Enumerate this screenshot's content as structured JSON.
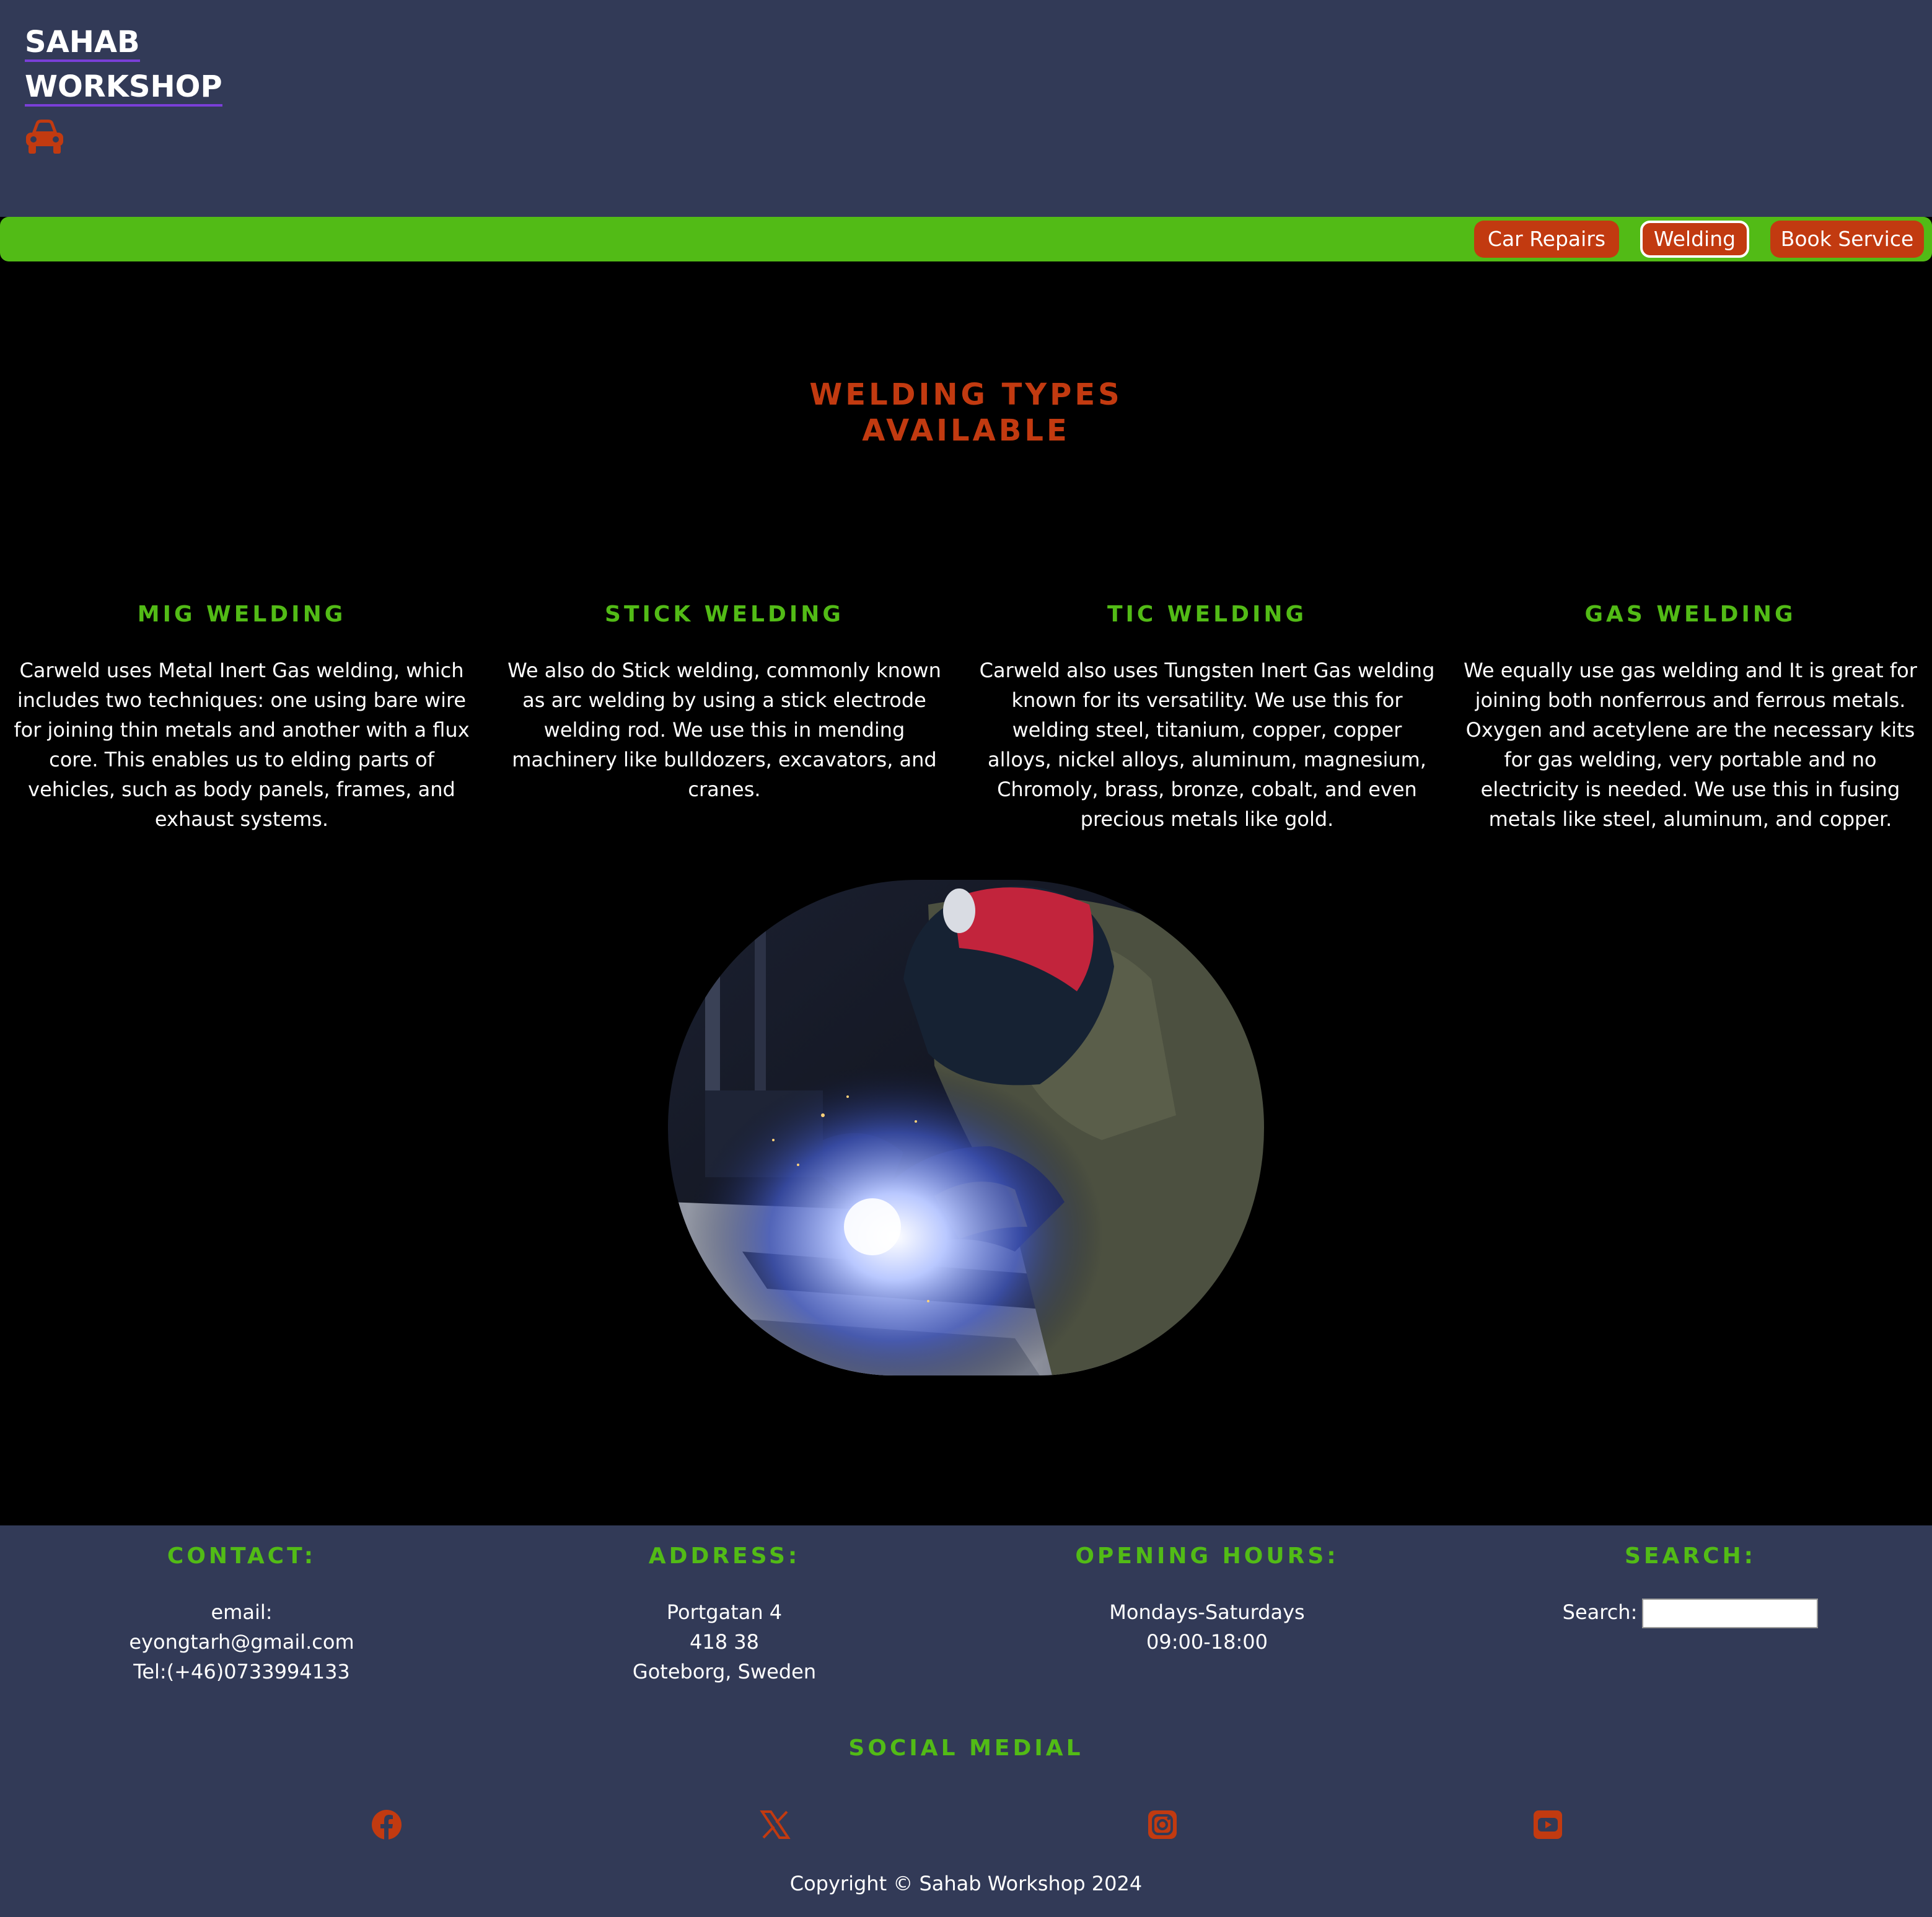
{
  "brand": {
    "line1": "SAHAB",
    "line2": "WORKSHOP",
    "icon": "car-icon"
  },
  "nav": {
    "items": [
      {
        "label": "Car Repairs",
        "active": false
      },
      {
        "label": "Welding",
        "active": true
      },
      {
        "label": "Book Service",
        "active": false
      }
    ]
  },
  "main": {
    "title_line1": "WELDING TYPES",
    "title_line2": "AVAILABLE",
    "columns": [
      {
        "heading": "MIG WELDING",
        "text": "Carweld uses Metal Inert Gas welding, which includes two techniques: one using bare wire for joining thin metals and another with a flux core. This enables us to elding parts of vehicles, such as body panels, frames, and exhaust systems."
      },
      {
        "heading": "STICK WELDING",
        "text": "We also do Stick welding, commonly known as arc welding by using a stick electrode welding rod. We use this in mending machinery like bulldozers, excavators, and cranes."
      },
      {
        "heading": "TIC WELDING",
        "text": "Carweld also uses Tungsten Inert Gas welding known for its versatility. We use this for welding steel, titanium, copper, copper alloys, nickel alloys, aluminum, magnesium, Chromoly, brass, bronze, cobalt, and even precious metals like gold."
      },
      {
        "heading": "GAS WELDING",
        "text": "We equally use gas welding and It is great for joining both nonferrous and ferrous metals. Oxygen and acetylene are the necessary kits for gas welding, very portable and no electricity is needed. We use this in fusing metals like steel, aluminum, and copper."
      }
    ]
  },
  "footer": {
    "contact": {
      "heading": "CONTACT:",
      "email_label": "email:",
      "email": "eyongtarh@gmail.com",
      "tel": "Tel:(+46)0733994133"
    },
    "address": {
      "heading": "ADDRESS:",
      "line1": "Portgatan 4",
      "line2": "418 38",
      "line3": "Goteborg, Sweden"
    },
    "hours": {
      "heading": "OPENING HOURS:",
      "line1": "Mondays-Saturdays",
      "line2": "09:00-18:00"
    },
    "search": {
      "heading": "SEARCH:",
      "label": "Search:",
      "value": ""
    },
    "social_title": "SOCIAL MEDIAL",
    "social_icons": [
      "facebook-icon",
      "x-icon",
      "instagram-icon",
      "youtube-icon"
    ],
    "copyright": "Copyright © Sahab Workshop 2024"
  },
  "colors": {
    "header_bg": "#323a57",
    "accent_orange": "#c23a10",
    "accent_green": "#52bb16",
    "body_bg": "#000000"
  }
}
